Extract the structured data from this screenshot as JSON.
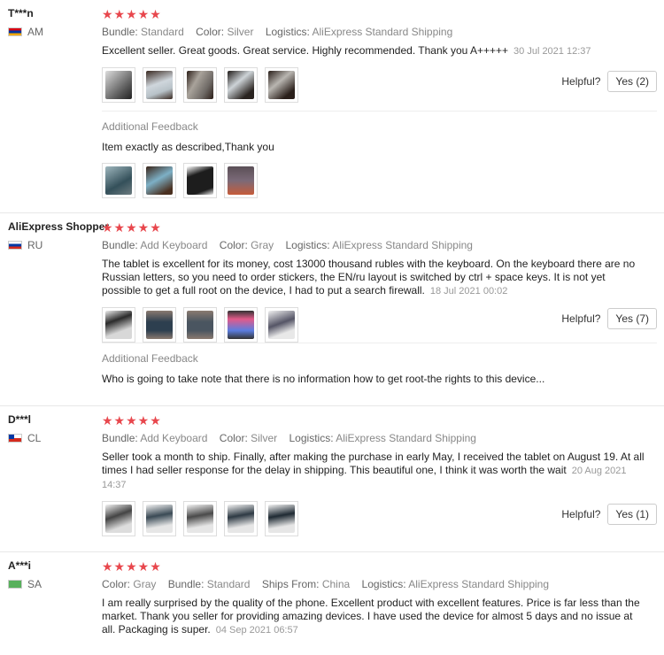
{
  "labels": {
    "bundle": "Bundle:",
    "color": "Color:",
    "logistics": "Logistics:",
    "ships_from": "Ships From:",
    "helpful": "Helpful?",
    "additional_feedback": "Additional Feedback"
  },
  "stars": "★★★★★",
  "reviews": [
    {
      "user": "T***n",
      "country": "AM",
      "bundle": "Standard",
      "color": "Silver",
      "logistics": "AliExpress Standard Shipping",
      "text": "Excellent seller. Great goods. Great service. Highly recommended. Thank you A+++++",
      "date": "30 Jul 2021 12:37",
      "yes": "Yes (2)",
      "additional_feedback": "Item exactly as described,Thank you"
    },
    {
      "user": "AliExpress Shopper",
      "country": "RU",
      "bundle": "Add Keyboard",
      "color": "Gray",
      "logistics": "AliExpress Standard Shipping",
      "text": "The tablet is excellent for its money, cost 13000 thousand rubles with the keyboard. On the keyboard there are no Russian letters, so you need to order stickers, the EN/ru layout is switched by ctrl + space keys. It is not yet possible to get a full root on the device, I had to put a search firewall.",
      "date": "18 Jul 2021 00:02",
      "yes": "Yes (7)",
      "additional_feedback": "Who is going to take note that there is no information how to get root-the rights to this device..."
    },
    {
      "user": "D***l",
      "country": "CL",
      "bundle": "Add Keyboard",
      "color": "Silver",
      "logistics": "AliExpress Standard Shipping",
      "text": "Seller took a month to ship. Finally, after making the purchase in early May, I received the tablet on August 19. At all times I had seller response for the delay in shipping. This beautiful one, I think it was worth the wait",
      "date": "20 Aug 2021 14:37",
      "yes": "Yes (1)"
    },
    {
      "user": "A***i",
      "country": "SA",
      "color": "Gray",
      "bundle": "Standard",
      "ships_from": "China",
      "logistics": "AliExpress Standard Shipping",
      "text": "I am really surprised by the quality of the phone. Excellent product with excellent features. Price is far less than the market. Thank you seller for providing amazing devices. I have used the device for almost 5 days and no issue at all. Packaging is super.",
      "date": "04 Sep 2021 06:57"
    }
  ]
}
